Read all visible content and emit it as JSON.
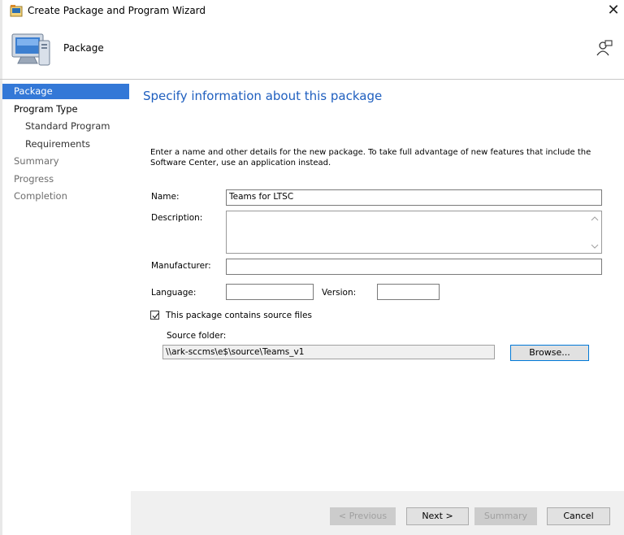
{
  "window": {
    "title": "Create Package and Program Wizard",
    "close_glyph": "✕"
  },
  "header": {
    "title": "Package",
    "icon": "computer-icon",
    "help_icon": "help-person-icon"
  },
  "nav": {
    "items": [
      {
        "label": "Package",
        "state": "selected"
      },
      {
        "label": "Program Type",
        "state": "normal"
      },
      {
        "label": "Standard Program",
        "state": "normal"
      },
      {
        "label": "Requirements",
        "state": "normal"
      },
      {
        "label": "Summary",
        "state": "dim"
      },
      {
        "label": "Progress",
        "state": "dim"
      },
      {
        "label": "Completion",
        "state": "dim"
      }
    ]
  },
  "page": {
    "heading": "Specify information about this package",
    "intro": "Enter a name and other details for the new package. To take full advantage of new features that include the Software Center, use an application instead."
  },
  "form": {
    "name_label": "Name:",
    "name_value": "Teams for LTSC",
    "description_label": "Description:",
    "description_value": "",
    "manufacturer_label": "Manufacturer:",
    "manufacturer_value": "",
    "language_label": "Language:",
    "language_value": "",
    "version_label": "Version:",
    "version_value": "",
    "source_checkbox_label": "This package contains source files",
    "source_checked": true,
    "source_folder_label": "Source folder:",
    "source_folder_value": "\\\\ark-sccms\\e$\\source\\Teams_v1",
    "browse_label": "Browse..."
  },
  "buttons": {
    "previous": "< Previous",
    "next": "Next >",
    "summary": "Summary",
    "cancel": "Cancel"
  },
  "colors": {
    "accent": "#3378d7",
    "heading": "#1f5fbf",
    "footer_bg": "#f0f0f0"
  }
}
